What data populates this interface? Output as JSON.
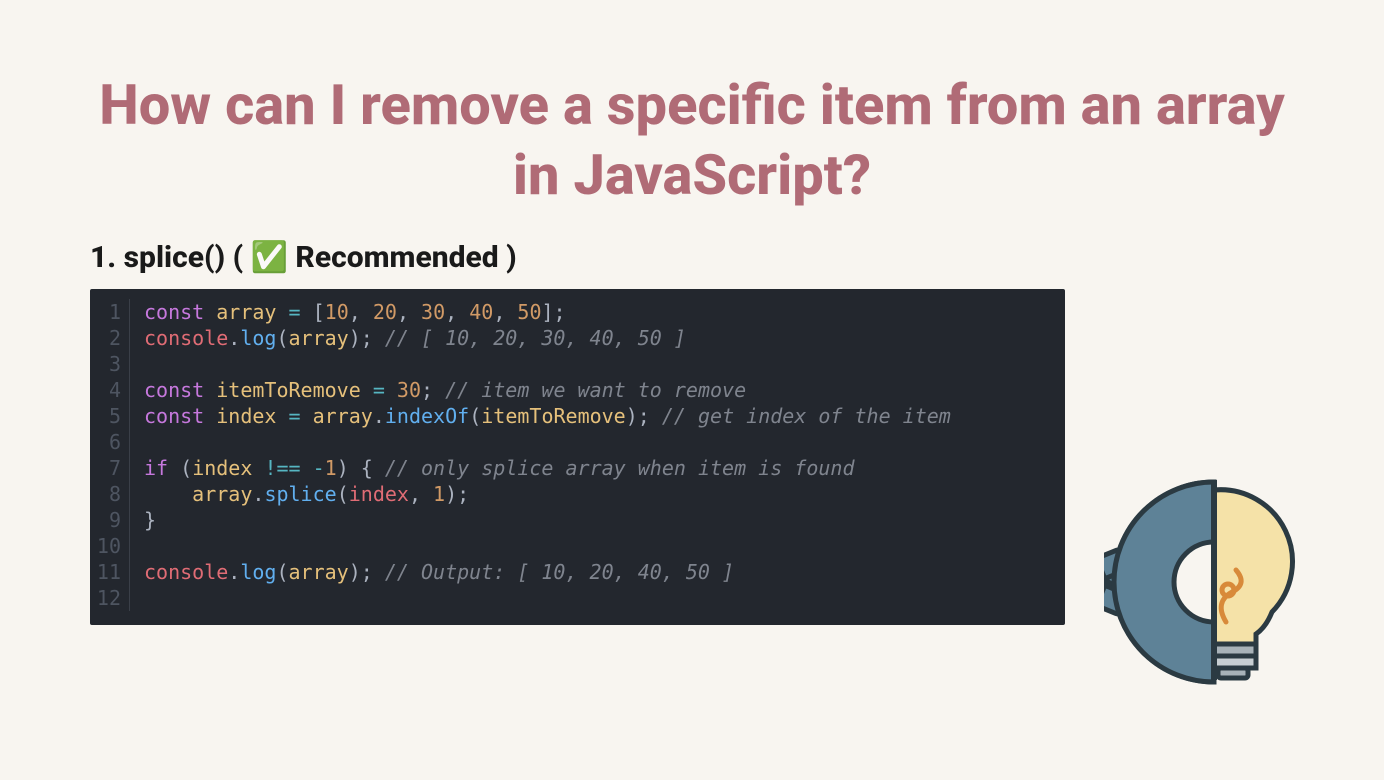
{
  "title": "How can I remove a specific item from an array in JavaScript?",
  "subtitle": "1. splice() ( ✅ Recommended )",
  "code": {
    "lines": [
      {
        "n": 1,
        "tokens": [
          [
            "kw",
            "const"
          ],
          [
            "pun",
            " "
          ],
          [
            "var",
            "array"
          ],
          [
            "pun",
            " "
          ],
          [
            "op",
            "="
          ],
          [
            "pun",
            " ["
          ],
          [
            "num",
            "10"
          ],
          [
            "pun",
            ", "
          ],
          [
            "num",
            "20"
          ],
          [
            "pun",
            ", "
          ],
          [
            "num",
            "30"
          ],
          [
            "pun",
            ", "
          ],
          [
            "num",
            "40"
          ],
          [
            "pun",
            ", "
          ],
          [
            "num",
            "50"
          ],
          [
            "pun",
            "];"
          ]
        ]
      },
      {
        "n": 2,
        "tokens": [
          [
            "prop",
            "console"
          ],
          [
            "pun",
            "."
          ],
          [
            "fn",
            "log"
          ],
          [
            "pun",
            "("
          ],
          [
            "var",
            "array"
          ],
          [
            "pun",
            "); "
          ],
          [
            "cmt",
            "// [ 10, 20, 30, 40, 50 ]"
          ]
        ]
      },
      {
        "n": 3,
        "tokens": []
      },
      {
        "n": 4,
        "tokens": [
          [
            "kw",
            "const"
          ],
          [
            "pun",
            " "
          ],
          [
            "var",
            "itemToRemove"
          ],
          [
            "pun",
            " "
          ],
          [
            "op",
            "="
          ],
          [
            "pun",
            " "
          ],
          [
            "num",
            "30"
          ],
          [
            "pun",
            "; "
          ],
          [
            "cmt",
            "// item we want to remove"
          ]
        ]
      },
      {
        "n": 5,
        "tokens": [
          [
            "kw",
            "const"
          ],
          [
            "pun",
            " "
          ],
          [
            "var",
            "index"
          ],
          [
            "pun",
            " "
          ],
          [
            "op",
            "="
          ],
          [
            "pun",
            " "
          ],
          [
            "var",
            "array"
          ],
          [
            "pun",
            "."
          ],
          [
            "fn",
            "indexOf"
          ],
          [
            "pun",
            "("
          ],
          [
            "var",
            "itemToRemove"
          ],
          [
            "pun",
            "); "
          ],
          [
            "cmt",
            "// get index of the item"
          ]
        ]
      },
      {
        "n": 6,
        "tokens": []
      },
      {
        "n": 7,
        "tokens": [
          [
            "kw",
            "if"
          ],
          [
            "pun",
            " ("
          ],
          [
            "var",
            "index"
          ],
          [
            "pun",
            " "
          ],
          [
            "op",
            "!=="
          ],
          [
            "pun",
            " "
          ],
          [
            "op",
            "-"
          ],
          [
            "num",
            "1"
          ],
          [
            "pun",
            ") { "
          ],
          [
            "cmt",
            "// only splice array when item is found"
          ]
        ]
      },
      {
        "n": 8,
        "tokens": [
          [
            "pun",
            "    "
          ],
          [
            "var",
            "array"
          ],
          [
            "pun",
            "."
          ],
          [
            "fn",
            "splice"
          ],
          [
            "pun",
            "("
          ],
          [
            "param",
            "index"
          ],
          [
            "pun",
            ", "
          ],
          [
            "num",
            "1"
          ],
          [
            "pun",
            ");"
          ]
        ]
      },
      {
        "n": 9,
        "tokens": [
          [
            "pun",
            "}"
          ]
        ]
      },
      {
        "n": 10,
        "tokens": []
      },
      {
        "n": 11,
        "tokens": [
          [
            "prop",
            "console"
          ],
          [
            "pun",
            "."
          ],
          [
            "fn",
            "log"
          ],
          [
            "pun",
            "("
          ],
          [
            "var",
            "array"
          ],
          [
            "pun",
            "); "
          ],
          [
            "cmt",
            "// Output: [ 10, 20, 40, 50 ]"
          ]
        ]
      },
      {
        "n": 12,
        "tokens": []
      }
    ]
  }
}
